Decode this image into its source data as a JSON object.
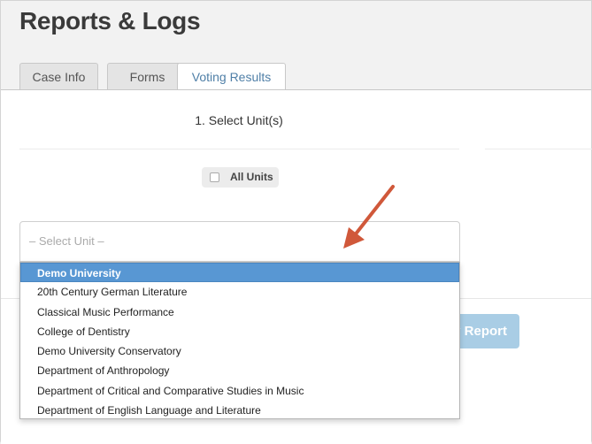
{
  "page": {
    "title": "Reports & Logs"
  },
  "tabs": [
    {
      "label": "Case Info"
    },
    {
      "label": "Forms"
    },
    {
      "label": "Voting Results"
    }
  ],
  "section": {
    "step_label": "1. Select Unit(s)"
  },
  "all_units": {
    "label": "All Units",
    "checked": false
  },
  "unit_select": {
    "placeholder": "– Select Unit –",
    "options": [
      "Demo University",
      "20th Century German Literature",
      "Classical Music Performance",
      "College of Dentistry",
      "Demo University Conservatory",
      "Department of Anthropology",
      "Department of Critical and Comparative Studies in Music",
      "Department of English Language and Literature"
    ],
    "highlighted": "Demo University"
  },
  "report_button": {
    "label": "y Report"
  },
  "colors": {
    "accent": "#5897d3",
    "arrow": "#d0583a",
    "button": "#a9cde5"
  }
}
